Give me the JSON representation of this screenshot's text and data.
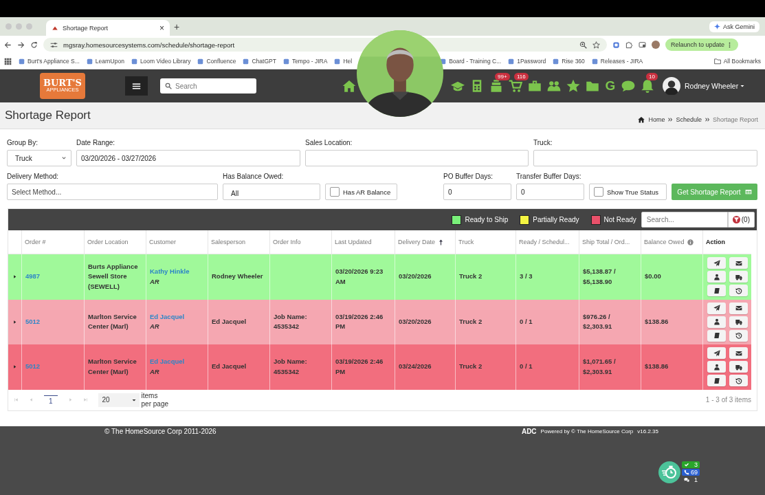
{
  "browser": {
    "tab_title": "Shortage Report",
    "close": "×",
    "new_tab": "+",
    "ask": "Ask Gemini",
    "url": "mgsray.homesourcesystems.com/schedule/shortage-report",
    "relaunch": "Relaunch to update",
    "bookmarks": [
      "Burt's Appliance S...",
      "LearnUpon",
      "Loom Video Library",
      "Confluence",
      "ChatGPT",
      "Tempo - JIRA",
      "Hel",
      "Board - Training C...",
      "1Password",
      "Rise 360",
      "Releases - JIRA"
    ],
    "all_bookmarks": "All Bookmarks"
  },
  "nav": {
    "logo": "BURT'S",
    "logo_sub": "APPLIANCES",
    "search": {
      "placeholder": "Search"
    },
    "icons": [
      {
        "kind": "home"
      },
      {
        "kind": "cap"
      },
      {
        "kind": "calculator"
      },
      {
        "kind": "register",
        "badge": "99+"
      },
      {
        "kind": "cart",
        "badge": "116"
      },
      {
        "kind": "briefcase"
      },
      {
        "kind": "people"
      },
      {
        "kind": "star"
      },
      {
        "kind": "folder"
      },
      {
        "kind": "letter",
        "text": "G"
      },
      {
        "kind": "chat"
      },
      {
        "kind": "bell",
        "badge": "10"
      }
    ],
    "user": "Rodney Wheeler"
  },
  "page": {
    "title": "Shortage Report",
    "breadcrumb": [
      "Home",
      "Schedule",
      "Shortage Report"
    ]
  },
  "filters": [
    {
      "kind": "select",
      "label": "Group By:",
      "value": "Truck"
    },
    {
      "kind": "text",
      "label": "Date Range:",
      "value": "03/20/2026 - 03/27/2026"
    },
    {
      "kind": "text",
      "label": "Sales Location:"
    },
    {
      "kind": "text",
      "label": "Truck:"
    },
    {
      "kind": "text",
      "label": "Delivery Method:",
      "placeholder": "Select Method..."
    },
    {
      "kind": "select",
      "label": "Has Balance Owed:",
      "value": "All"
    },
    {
      "kind": "checkbox",
      "label": "Has AR Balance",
      "checked": false
    },
    {
      "kind": "text",
      "label": "PO Buffer Days:",
      "value": "0"
    },
    {
      "kind": "text",
      "label": "Transfer Buffer Days:",
      "value": "0"
    },
    {
      "kind": "checkbox",
      "label": "Show True Status",
      "checked": false
    },
    {
      "kind": "button",
      "label": "Get Shortage Report"
    }
  ],
  "legend": [
    {
      "label": "Ready to Ship",
      "color": "#7af07a"
    },
    {
      "label": "Partially Ready",
      "color": "#f5f542"
    },
    {
      "label": "Not Ready",
      "color": "#e9516a"
    }
  ],
  "grid_search": {
    "placeholder": "Search..."
  },
  "filter_count": "(0)",
  "table": {
    "columns": [
      {
        "label": "Order #"
      },
      {
        "label": "Order Location"
      },
      {
        "label": "Customer"
      },
      {
        "label": "Salesperson"
      },
      {
        "label": "Order Info"
      },
      {
        "label": "Last Updated"
      },
      {
        "label": "Delivery Date",
        "sorted": true
      },
      {
        "label": "Truck"
      },
      {
        "label": "Ready / Schedul..."
      },
      {
        "label": "Ship Total / Ord..."
      },
      {
        "label": "Balance Owed",
        "info": true
      },
      {
        "label": "Action"
      }
    ],
    "rows": [
      {
        "color": "#a0f99a",
        "order": "4987",
        "location": "Burts Appliance Sewell Store (SEWELL)",
        "customer": "Kathy Hinkle",
        "customer_tag": "AR",
        "salesperson": "Rodney Wheeler",
        "order_info": "",
        "last_updated": "03/20/2026 9:23 AM",
        "delivery_date": "03/20/2026",
        "truck": "Truck 2",
        "ready": "3 / 3",
        "ship_total": "$5,138.87 / $5,138.90",
        "balance": "$0.00"
      },
      {
        "color": "#f5a7b1",
        "order": "5012",
        "location": "Marlton Service Center (Marl)",
        "customer": "Ed Jacquel",
        "customer_tag": "AR",
        "salesperson": "Ed Jacquel",
        "order_info": "Job Name: 4535342",
        "last_updated": "03/19/2026 2:46 PM",
        "delivery_date": "03/20/2026",
        "truck": "Truck 2",
        "ready": "0 / 1",
        "ship_total": "$976.26 / $2,303.91",
        "balance": "$138.86"
      },
      {
        "color": "#f26e7e",
        "order": "5012",
        "location": "Marlton Service Center (Marl)",
        "customer": "Ed Jacquel",
        "customer_tag": "AR",
        "salesperson": "Ed Jacquel",
        "order_info": "Job Name: 4535342",
        "last_updated": "03/19/2026 2:46 PM",
        "delivery_date": "03/24/2026",
        "truck": "Truck 2",
        "ready": "0 / 1",
        "ship_total": "$1,071.65 / $2,303.91",
        "balance": "$138.86"
      }
    ]
  },
  "pager": {
    "pages": [
      {
        "label": "1",
        "selected": true
      }
    ],
    "page_size": "20",
    "page_size_label": "items per page",
    "summary": "1 - 3 of 3 items"
  },
  "footer": {
    "copyright": "© The HomeSource Corp 2011-2026",
    "code": "ADC",
    "powered": "Powered by © The HomeSource Corp",
    "version": "v16.2.35"
  },
  "widget": {
    "done": "3",
    "calls": "69",
    "messages": "1"
  }
}
